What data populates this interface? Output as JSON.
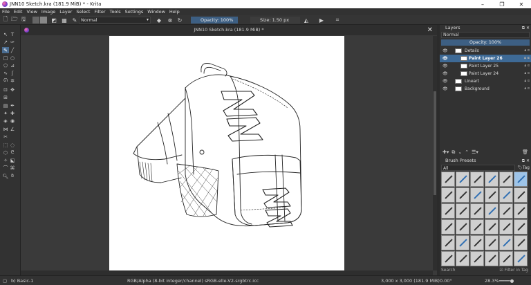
{
  "window": {
    "title": "JNN10 Sketch.kra (181.9 MiB) * - Krita",
    "controls": [
      "–",
      "❐",
      "✕"
    ]
  },
  "menu": [
    "File",
    "Edit",
    "View",
    "Image",
    "Layer",
    "Select",
    "Filter",
    "Tools",
    "Settings",
    "Window",
    "Help"
  ],
  "toolbar": {
    "blend_mode": "Normal",
    "opacity": "Opacity: 100%",
    "size": "Size: 1.50 px"
  },
  "document": {
    "tab_title": "JNN10 Sketch.kra (181.9 MiB) *"
  },
  "layers_panel": {
    "title": "Layers",
    "blend_mode": "Normal",
    "opacity": "Opacity: 100%",
    "layers": [
      {
        "name": "Details",
        "indent": 0,
        "selected": false,
        "group": true
      },
      {
        "name": "Paint Layer 26",
        "indent": 1,
        "selected": true,
        "group": false
      },
      {
        "name": "Paint Layer 25",
        "indent": 1,
        "selected": false,
        "group": false
      },
      {
        "name": "Paint Layer 24",
        "indent": 1,
        "selected": false,
        "group": false
      },
      {
        "name": "Lineart",
        "indent": 0,
        "selected": false,
        "group": true
      },
      {
        "name": "Background",
        "indent": 0,
        "selected": false,
        "group": false
      }
    ]
  },
  "brush_panel": {
    "title": "Brush Presets",
    "filter": "All",
    "tag": "Tag",
    "search_placeholder": "Search",
    "filter_in_tag": "Filter in Tag"
  },
  "status": {
    "brush": "b) Basic-1",
    "colorspace": "RGB/Alpha (8-bit integer/channel)  sRGB-elle-V2-srgbtrc.icc",
    "dimensions": "3,000 x 3,000 (181.9 MiB)",
    "rotation": "0.00°",
    "zoom": "28.3%"
  },
  "colors": {
    "accent": "#3e6a96",
    "canvas": "#ffffff",
    "bg": "#2b2b2b"
  }
}
